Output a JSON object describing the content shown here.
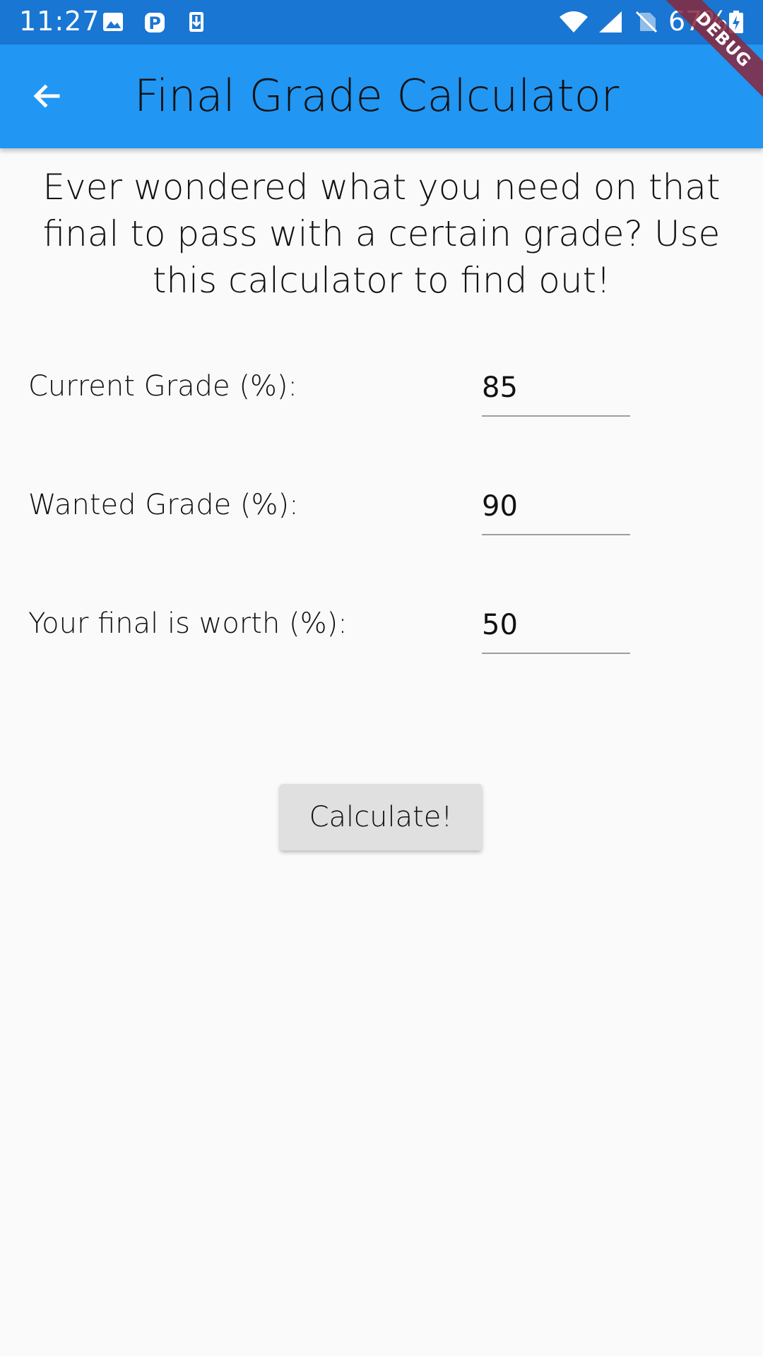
{
  "status_bar": {
    "time": "11:27",
    "battery": "67%",
    "icons": [
      "image-icon",
      "parking-icon",
      "download-icon",
      "wifi-icon",
      "signal-icon",
      "no-sim-icon",
      "battery-charging-icon"
    ]
  },
  "app_bar": {
    "title": "Final Grade Calculator",
    "back_icon": "arrow-back-icon",
    "background_color": "#2196f3"
  },
  "debug_banner": {
    "label": "DEBUG"
  },
  "intro": {
    "text": "Ever wondered what you need on that final to pass with a certain grade? Use this calculator to find out!"
  },
  "form": {
    "current_grade": {
      "label": "Current Grade (%):",
      "value": "85"
    },
    "wanted_grade": {
      "label": "Wanted Grade (%):",
      "value": "90"
    },
    "final_worth": {
      "label": "Your final is worth (%):",
      "value": "50"
    },
    "calculate_label": "Calculate!"
  }
}
